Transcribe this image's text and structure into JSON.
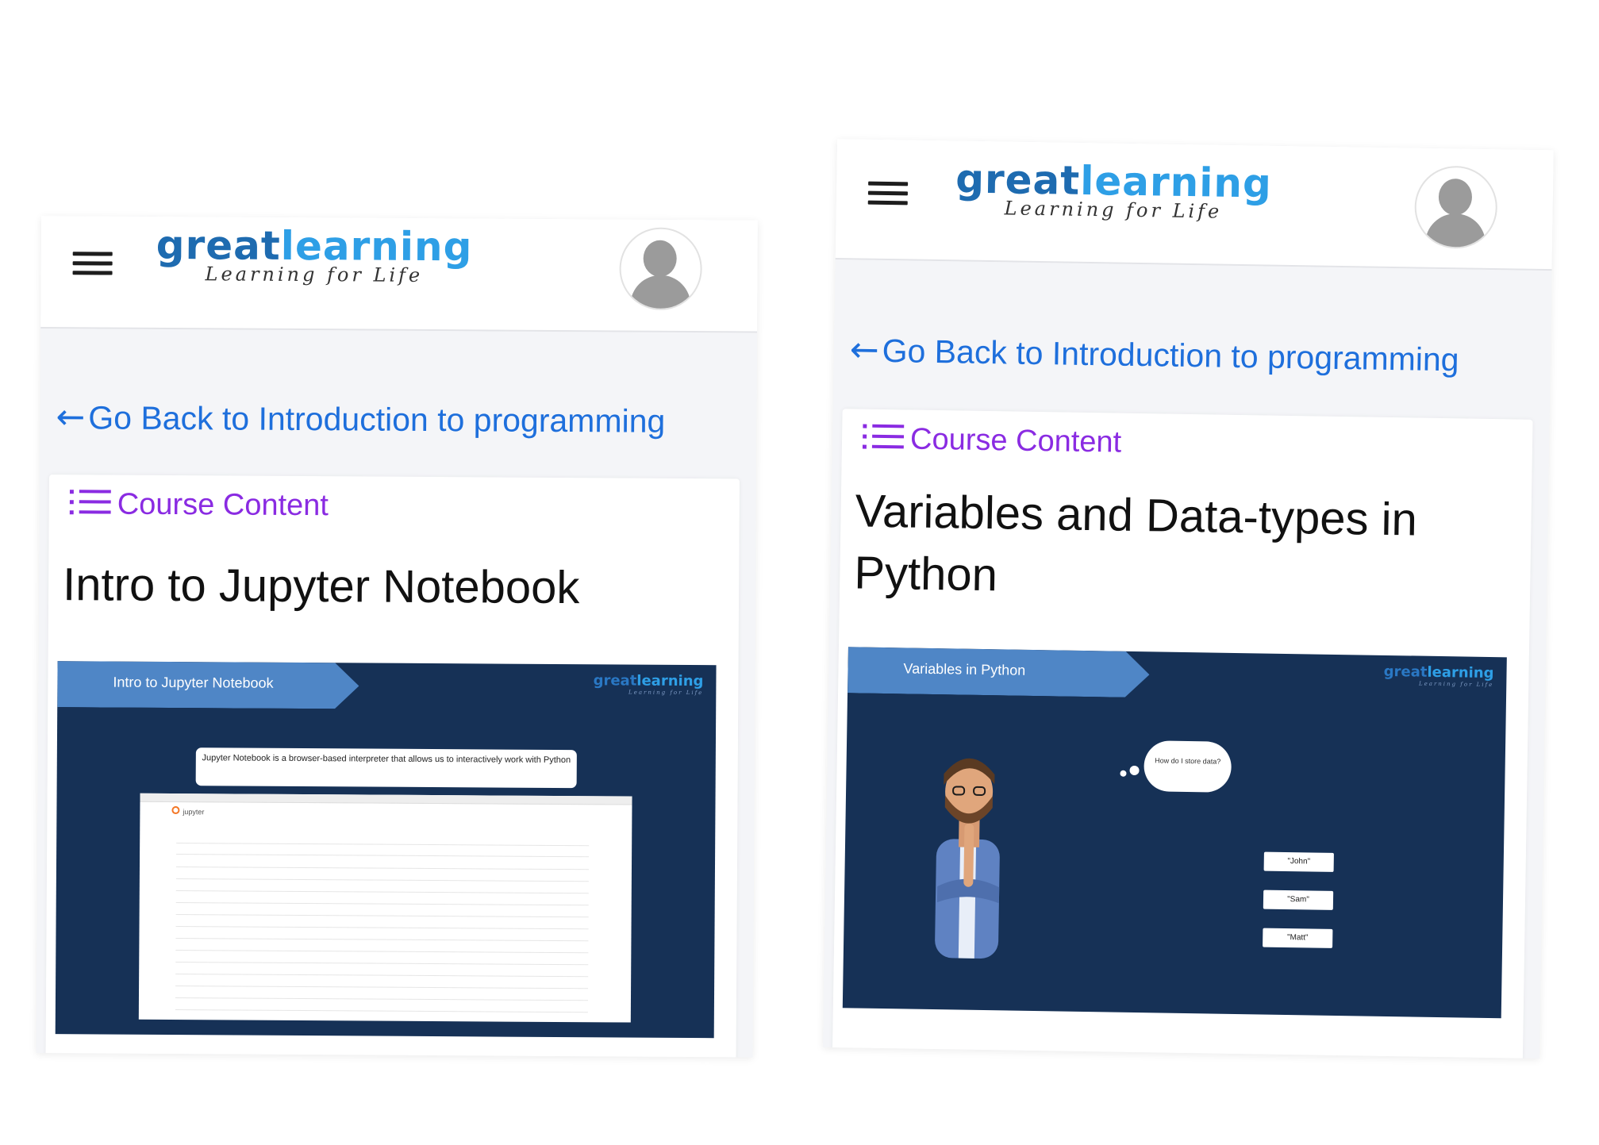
{
  "screens": [
    {
      "header": {
        "logo_brand_part1": "great",
        "logo_brand_part2": "learning",
        "logo_tagline": "Learning for Life"
      },
      "back_link": {
        "arrow": "←",
        "label": "Go Back to Introduction to programming"
      },
      "course_content_label": "Course Content",
      "lesson_title": "Intro to Jupyter Notebook",
      "slide": {
        "banner": "Intro to Jupyter Notebook",
        "logo_brand_part1": "great",
        "logo_brand_part2": "learning",
        "logo_tagline": "Learning for Life",
        "callout": "Jupyter Notebook is a browser-based interpreter that allows us to interactively work with Python",
        "screenshot_app_name": "jupyter"
      }
    },
    {
      "header": {
        "logo_brand_part1": "great",
        "logo_brand_part2": "learning",
        "logo_tagline": "Learning for Life"
      },
      "back_link": {
        "arrow": "←",
        "label": "Go Back to Introduction to programming"
      },
      "course_content_label": "Course Content",
      "lesson_title": "Variables and Data-types in Python",
      "slide": {
        "banner": "Variables in Python",
        "logo_brand_part1": "great",
        "logo_brand_part2": "learning",
        "logo_tagline": "Learning for Life",
        "thought": "How do I store data?",
        "name_tags": [
          "\"John\"",
          "\"Sam\"",
          "\"Matt\""
        ]
      }
    }
  ],
  "colors": {
    "link_blue": "#1e6fdc",
    "course_content_purple": "#8a2be2",
    "slide_navy": "#163156",
    "banner_blue": "#4f86c6"
  },
  "icons": [
    "menu-icon",
    "avatar-icon",
    "arrow-left-icon",
    "list-icon"
  ]
}
